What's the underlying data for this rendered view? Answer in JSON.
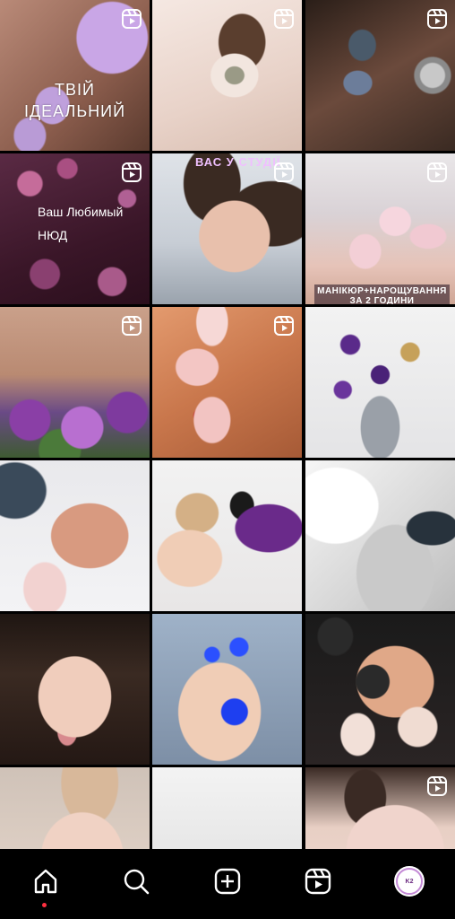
{
  "tiles": [
    {
      "id": "toe-nails-lilac",
      "is_reel": true,
      "text": "ТВІЙ\nІДЕАЛЬНИЙ"
    },
    {
      "id": "brow-closeup",
      "is_reel": true
    },
    {
      "id": "glitter-nails-rings",
      "is_reel": true
    },
    {
      "id": "bokeh-nude",
      "is_reel": true,
      "text": "Ваш Любимый\nНЮД"
    },
    {
      "id": "woman-portrait-studio",
      "is_reel": true,
      "text": "ВАС У СТУДІЇ"
    },
    {
      "id": "pink-almond-nails",
      "is_reel": true,
      "text": "МАНІКЮР+НАРОЩУВАННЯ\nЗА 2 ГОДИНИ"
    },
    {
      "id": "french-nails-flowers",
      "is_reel": true
    },
    {
      "id": "cherry-nails",
      "is_reel": true
    },
    {
      "id": "scissors-dried-flowers",
      "is_reel": false
    },
    {
      "id": "white-tip-nails-ring",
      "is_reel": false
    },
    {
      "id": "brow-master-at-work",
      "is_reel": false
    },
    {
      "id": "brush-white-cream",
      "is_reel": false
    },
    {
      "id": "woman-brows-portrait",
      "is_reel": false
    },
    {
      "id": "blue-toe-nails",
      "is_reel": false
    },
    {
      "id": "black-nude-nails",
      "is_reel": false
    },
    {
      "id": "woman-forehead",
      "is_reel": false
    },
    {
      "id": "lavender-field",
      "is_reel": false
    },
    {
      "id": "woman-eyes-closeup",
      "is_reel": true
    }
  ],
  "nav": {
    "items": [
      "home-icon",
      "search-icon",
      "create-icon",
      "reels-icon",
      "profile-avatar"
    ],
    "avatar_text": "K2",
    "active": "home"
  },
  "colors": {
    "background": "#000000",
    "notification_dot": "#ff3040"
  }
}
